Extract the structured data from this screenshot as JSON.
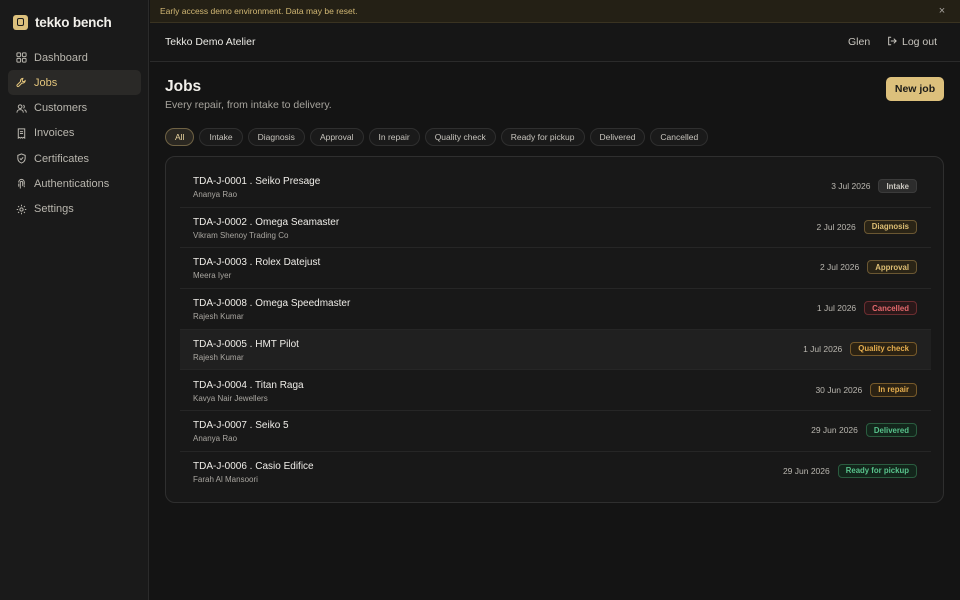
{
  "brand": {
    "name": "tekko bench",
    "logo_icon": "watch-logo-icon"
  },
  "sidebar": {
    "items": [
      {
        "label": "Dashboard",
        "icon": "grid-icon",
        "active": false
      },
      {
        "label": "Jobs",
        "icon": "wrench-icon",
        "active": true
      },
      {
        "label": "Customers",
        "icon": "users-icon",
        "active": false
      },
      {
        "label": "Invoices",
        "icon": "receipt-icon",
        "active": false
      },
      {
        "label": "Certificates",
        "icon": "shield-icon",
        "active": false
      },
      {
        "label": "Authentications",
        "icon": "fingerprint-icon",
        "active": false
      },
      {
        "label": "Settings",
        "icon": "gear-icon",
        "active": false
      }
    ]
  },
  "banner": {
    "text": "Early access demo environment. Data may be reset.",
    "close": "×"
  },
  "header": {
    "org": "Tekko Demo Atelier",
    "user": "Glen",
    "logout_label": "Log out"
  },
  "main": {
    "title": "Jobs",
    "subtitle": "Every repair, from intake to delivery.",
    "new_job_label": "New job",
    "filters": [
      {
        "label": "All",
        "active": true
      },
      {
        "label": "Intake",
        "active": false
      },
      {
        "label": "Diagnosis",
        "active": false
      },
      {
        "label": "Approval",
        "active": false
      },
      {
        "label": "In repair",
        "active": false
      },
      {
        "label": "Quality check",
        "active": false
      },
      {
        "label": "Ready for pickup",
        "active": false
      },
      {
        "label": "Delivered",
        "active": false
      },
      {
        "label": "Cancelled",
        "active": false
      }
    ],
    "jobs": [
      {
        "title": "TDA-J-0001 . Seiko Presage",
        "customer": "Ananya Rao",
        "date": "3 Jul 2026",
        "status": "Intake",
        "tone": "neutral"
      },
      {
        "title": "TDA-J-0002 . Omega Seamaster",
        "customer": "Vikram Shenoy Trading Co",
        "date": "2 Jul 2026",
        "status": "Diagnosis",
        "tone": "gold"
      },
      {
        "title": "TDA-J-0003 . Rolex Datejust",
        "customer": "Meera Iyer",
        "date": "2 Jul 2026",
        "status": "Approval",
        "tone": "gold"
      },
      {
        "title": "TDA-J-0008 . Omega Speedmaster",
        "customer": "Rajesh Kumar",
        "date": "1 Jul 2026",
        "status": "Cancelled",
        "tone": "red"
      },
      {
        "title": "TDA-J-0005 . HMT Pilot",
        "customer": "Rajesh Kumar",
        "date": "1 Jul 2026",
        "status": "Quality check",
        "tone": "orange"
      },
      {
        "title": "TDA-J-0004 . Titan Raga",
        "customer": "Kavya Nair Jewellers",
        "date": "30 Jun 2026",
        "status": "In repair",
        "tone": "orange"
      },
      {
        "title": "TDA-J-0007 . Seiko 5",
        "customer": "Ananya Rao",
        "date": "29 Jun 2026",
        "status": "Delivered",
        "tone": "green"
      },
      {
        "title": "TDA-J-0006 . Casio Edifice",
        "customer": "Farah Al Mansoori",
        "date": "29 Jun 2026",
        "status": "Ready for pickup",
        "tone": "green"
      }
    ]
  },
  "colors": {
    "accent": "#dcc07c",
    "background": "#141414",
    "sidebar": "#1a1a1a",
    "banner_text": "#d2b874"
  }
}
